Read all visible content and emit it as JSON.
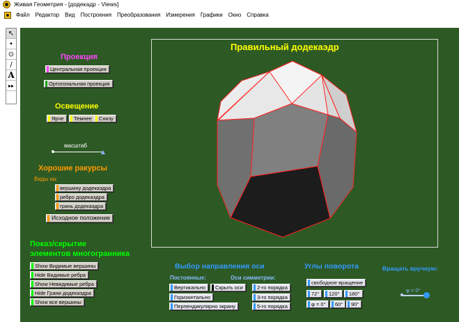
{
  "window": {
    "title": "Живая Геометрия - [додекадр - Views]"
  },
  "menu": [
    "Файл",
    "Редактор",
    "Вид",
    "Построения",
    "Преобразования",
    "Измерения",
    "Графики",
    "Окно",
    "Справка"
  ],
  "tools": [
    {
      "icon": "arrow-select-icon",
      "glyph": "↖"
    },
    {
      "icon": "point-tool-icon",
      "glyph": "•"
    },
    {
      "icon": "compass-tool-icon",
      "glyph": "⊙"
    },
    {
      "icon": "segment-tool-icon",
      "glyph": "∕"
    },
    {
      "icon": "text-tool-icon",
      "glyph": "A"
    },
    {
      "icon": "custom-tool-icon",
      "glyph": "▸▸"
    }
  ],
  "heading": "Правильный додекаэдр",
  "projection": {
    "title": "Проекция",
    "central": "Центральная проекция",
    "orthogonal": "Ортогональная проекция"
  },
  "lighting": {
    "title": "Освещение",
    "brighter": "Ярче",
    "darker": "Темнее",
    "below": "Снизу"
  },
  "scale": {
    "label": "масштаб"
  },
  "views": {
    "title": "Хорошие ракурсы",
    "subtitle": "Виды на:",
    "vertex": "вершину додекаэдра",
    "edge": "ребро додекаэдра",
    "face": "грань додекаэдра",
    "reset": "Исходное положение"
  },
  "visibility": {
    "title_line1": "Показ/скрытие",
    "title_line2": "элементов многогранника",
    "show_visible_vertices": "Show Видимые вершины",
    "hide_visible_edges": "Hide Видимые ребра",
    "show_hidden_edges": "Show Невидимые ребра",
    "hide_faces": "Hide Грани додекаэдра",
    "show_all_vertices": "Show все вершины"
  },
  "axis": {
    "title": "Выбор направления оси",
    "constant_label": "Постоянные:",
    "symmetry_label": "Оси симметрии:",
    "vertical": "Вертикально",
    "hide_axis": "Скрыть оси",
    "horizontal": "Горизонтально",
    "perpendicular": "Перпендикулярно экрану",
    "order2": "2-го порядка",
    "order3": "3-го порядка",
    "order5": "5-го порядка"
  },
  "angles": {
    "title": "Углы поворота",
    "free": "свободное вращение",
    "a72": "72°",
    "a120": "120°",
    "a180": "180°",
    "phi0": "φ = 0°",
    "a60": "60°",
    "a90": "90°"
  },
  "manual": {
    "title": "Вращать вручную:",
    "phi_label": "φ = 0°"
  },
  "colors": {
    "work_bg": "#2d5a24",
    "heading": "#ffff00",
    "projection_title": "#ff44ff",
    "lighting_title": "#ffff00",
    "views_title": "#ff9900",
    "visibility_title": "#00ff00",
    "axis_title": "#3399ff",
    "edge": "#ff2222"
  }
}
